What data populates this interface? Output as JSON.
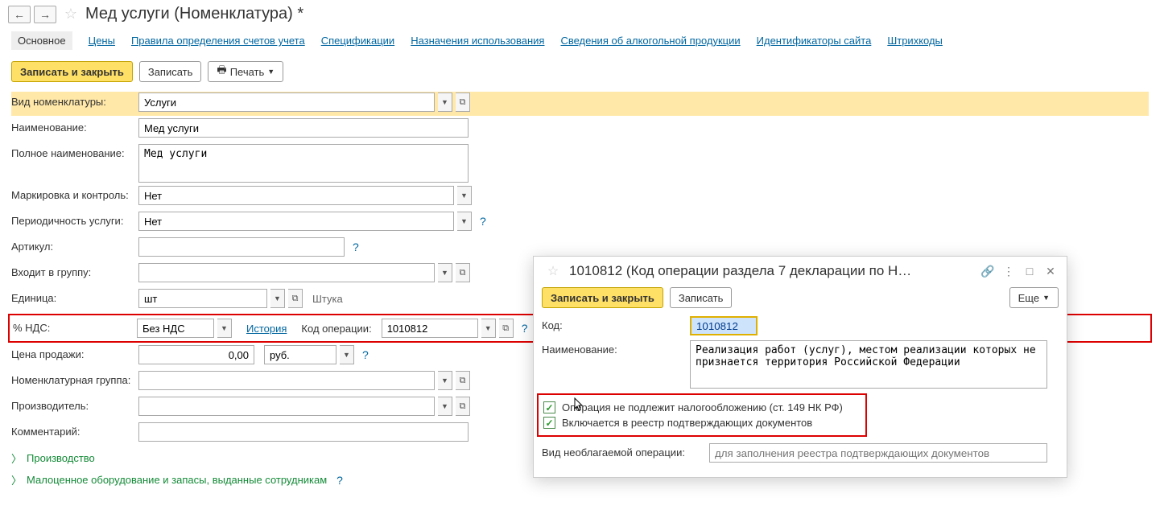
{
  "header": {
    "title": "Мед услуги (Номенклатура) *"
  },
  "tabs": {
    "main": "Основное",
    "items": [
      "Цены",
      "Правила определения счетов учета",
      "Спецификации",
      "Назначения использования",
      "Сведения об алкогольной продукции",
      "Идентификаторы сайта",
      "Штрихкоды"
    ]
  },
  "toolbar": {
    "save_close": "Записать и закрыть",
    "save": "Записать",
    "print": "Печать"
  },
  "form": {
    "type_label": "Вид номенклатуры:",
    "type_value": "Услуги",
    "name_label": "Наименование:",
    "name_value": "Мед услуги",
    "fullname_label": "Полное наименование:",
    "fullname_value": "Мед услуги",
    "marking_label": "Маркировка и контроль:",
    "marking_value": "Нет",
    "period_label": "Периодичность услуги:",
    "period_value": "Нет",
    "sku_label": "Артикул:",
    "sku_value": "",
    "group_label": "Входит в группу:",
    "group_value": "",
    "unit_label": "Единица:",
    "unit_value": "шт",
    "unit_text": "Штука",
    "vat_label": "% НДС:",
    "vat_value": "Без НДС",
    "history_link": "История",
    "opcode_label": "Код операции:",
    "opcode_value": "1010812",
    "price_label": "Цена продажи:",
    "price_value": "0,00",
    "currency_value": "руб.",
    "nomgroup_label": "Номенклатурная группа:",
    "nomgroup_value": "",
    "producer_label": "Производитель:",
    "producer_value": "",
    "comment_label": "Комментарий:",
    "comment_value": "",
    "collapse1": "Производство",
    "collapse2": "Малоценное оборудование и запасы, выданные сотрудникам"
  },
  "dialog": {
    "title": "1010812 (Код операции раздела 7 декларации по Н…",
    "save_close": "Записать и закрыть",
    "save": "Записать",
    "more": "Еще",
    "code_label": "Код:",
    "code_value": "1010812",
    "name_label": "Наименование:",
    "name_value": "Реализация работ (услуг), местом реализации которых не признается территория Российской Федерации",
    "chk1": "Операция не подлежит налогообложению (ст. 149 НК РФ)",
    "chk2": "Включается в реестр подтверждающих документов",
    "vid_label": "Вид необлагаемой операции:",
    "vid_placeholder": "для заполнения реестра подтверждающих документов"
  }
}
